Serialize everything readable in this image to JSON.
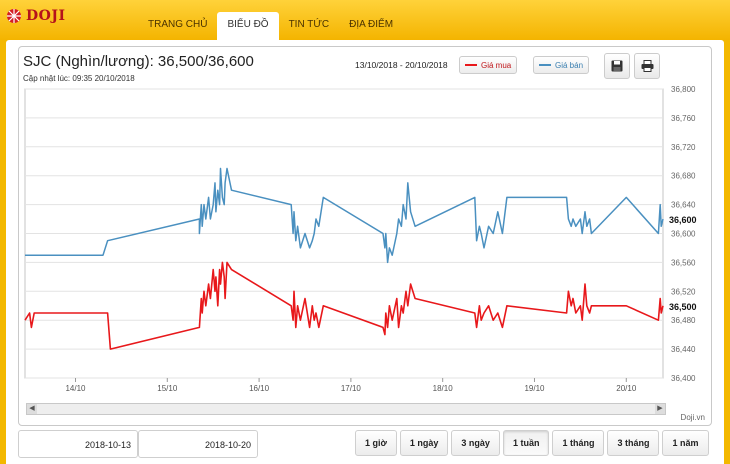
{
  "brand": {
    "name": "DOJI"
  },
  "nav": [
    {
      "label": "TRANG CHỦ",
      "active": false
    },
    {
      "label": "BIỂU ĐỒ",
      "active": true
    },
    {
      "label": "TIN TỨC",
      "active": false
    },
    {
      "label": "ĐỊA ĐIỂM",
      "active": false
    }
  ],
  "header": {
    "title": "SJC (Nghìn/lương): 36,500/36,600",
    "updated": "Cập nhật lúc: 09:35 20/10/2018",
    "range": "13/10/2018 - 20/10/2018"
  },
  "legend": {
    "buy": "Giá mua",
    "sell": "Giá bán"
  },
  "colors": {
    "buy": "#e8181b",
    "sell": "#4a90c0",
    "bg": "#f3b800"
  },
  "icons": {
    "save": "save-icon",
    "print": "print-icon"
  },
  "credit": "Doji.vn",
  "dates": {
    "from": "2018-10-13",
    "to": "2018-10-20"
  },
  "ranges": [
    {
      "label": "1 giờ",
      "active": false
    },
    {
      "label": "1 ngày",
      "active": false
    },
    {
      "label": "3 ngày",
      "active": false
    },
    {
      "label": "1 tuần",
      "active": true
    },
    {
      "label": "1 tháng",
      "active": false
    },
    {
      "label": "3 tháng",
      "active": false
    },
    {
      "label": "1 năm",
      "active": false
    }
  ],
  "chart_data": {
    "type": "line",
    "xlabel": "",
    "ylabel": "",
    "x_ticks": [
      "14/10",
      "15/10",
      "16/10",
      "17/10",
      "18/10",
      "19/10",
      "20/10"
    ],
    "x_range_days": [
      13.45,
      20.4
    ],
    "ylim": [
      36400,
      36800
    ],
    "y_ticks": [
      "36,400",
      "36,440",
      "36,480",
      "36,520",
      "36,560",
      "36,600",
      "36,640",
      "36,680",
      "36,720",
      "36,760",
      "36,800"
    ],
    "grid": true,
    "last_values": {
      "buy": "36,500",
      "sell": "36,600"
    },
    "series": [
      {
        "name": "Giá bán",
        "x": [
          13.45,
          14.3,
          14.35,
          15.35,
          15.35,
          15.37,
          15.38,
          15.4,
          15.42,
          15.45,
          15.47,
          15.5,
          15.52,
          15.53,
          15.55,
          15.57,
          15.58,
          15.6,
          15.62,
          15.63,
          15.65,
          15.7,
          16.35,
          16.37,
          16.38,
          16.4,
          16.42,
          16.45,
          16.5,
          16.55,
          16.58,
          16.6,
          16.62,
          16.65,
          16.7,
          17.35,
          17.37,
          17.38,
          17.4,
          17.42,
          17.45,
          17.5,
          17.52,
          17.55,
          17.57,
          17.6,
          17.62,
          17.65,
          17.7,
          18.35,
          18.37,
          18.4,
          18.42,
          18.45,
          18.5,
          18.55,
          18.6,
          18.65,
          18.7,
          19.35,
          19.37,
          19.4,
          19.42,
          19.45,
          19.5,
          19.52,
          19.55,
          19.57,
          19.6,
          19.62,
          20.0,
          20.35,
          20.37,
          20.38,
          20.4
        ],
        "values": [
          36570,
          36570,
          36590,
          36620,
          36600,
          36640,
          36610,
          36640,
          36620,
          36650,
          36620,
          36640,
          36670,
          36630,
          36660,
          36640,
          36690,
          36650,
          36640,
          36670,
          36690,
          36660,
          36640,
          36600,
          36630,
          36590,
          36610,
          36580,
          36600,
          36580,
          36590,
          36600,
          36620,
          36610,
          36650,
          36600,
          36580,
          36600,
          36560,
          36580,
          36570,
          36600,
          36620,
          36610,
          36640,
          36620,
          36670,
          36630,
          36610,
          36650,
          36590,
          36610,
          36600,
          36580,
          36610,
          36600,
          36630,
          36600,
          36650,
          36650,
          36620,
          36610,
          36620,
          36610,
          36620,
          36600,
          36630,
          36610,
          36620,
          36600,
          36650,
          36600,
          36640,
          36610,
          36620
        ]
      },
      {
        "name": "Giá mua",
        "x": [
          13.45,
          13.5,
          13.52,
          13.55,
          14.35,
          14.38,
          15.35,
          15.37,
          15.38,
          15.4,
          15.42,
          15.45,
          15.47,
          15.5,
          15.52,
          15.53,
          15.55,
          15.57,
          15.58,
          15.6,
          15.62,
          15.63,
          15.65,
          15.7,
          16.35,
          16.37,
          16.38,
          16.4,
          16.42,
          16.45,
          16.5,
          16.55,
          16.58,
          16.6,
          16.62,
          16.65,
          16.7,
          17.35,
          17.37,
          17.38,
          17.4,
          17.42,
          17.45,
          17.5,
          17.52,
          17.55,
          17.57,
          17.6,
          17.62,
          17.65,
          17.7,
          18.35,
          18.37,
          18.4,
          18.42,
          18.45,
          18.5,
          18.55,
          18.6,
          18.65,
          18.7,
          19.35,
          19.37,
          19.4,
          19.42,
          19.45,
          19.5,
          19.52,
          19.55,
          19.57,
          19.6,
          19.62,
          20.0,
          20.35,
          20.37,
          20.38,
          20.4
        ],
        "values": [
          36480,
          36490,
          36470,
          36490,
          36490,
          36440,
          36470,
          36510,
          36490,
          36520,
          36500,
          36530,
          36510,
          36550,
          36520,
          36540,
          36500,
          36550,
          36530,
          36560,
          36540,
          36510,
          36560,
          36550,
          36500,
          36480,
          36520,
          36470,
          36500,
          36480,
          36510,
          36470,
          36500,
          36480,
          36490,
          36470,
          36500,
          36470,
          36460,
          36490,
          36470,
          36500,
          36480,
          36510,
          36470,
          36500,
          36490,
          36520,
          36500,
          36530,
          36510,
          36490,
          36470,
          36500,
          36480,
          36490,
          36500,
          36480,
          36490,
          36470,
          36500,
          36490,
          36520,
          36500,
          36510,
          36490,
          36500,
          36480,
          36530,
          36500,
          36490,
          36500,
          36500,
          36480,
          36510,
          36490,
          36500
        ]
      }
    ]
  }
}
